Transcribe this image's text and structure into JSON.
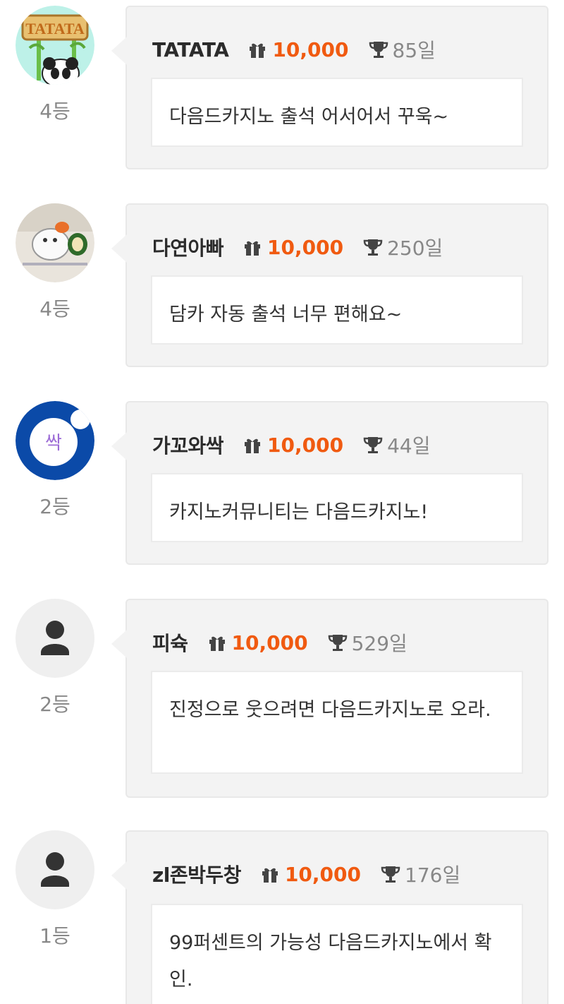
{
  "comments": [
    {
      "rank": "4등",
      "username": "TATATA",
      "points": "10,000",
      "days": "85일",
      "message": "다음드카지노 출석 어서어서 꾸욱~",
      "avatar_text": "TATATA"
    },
    {
      "rank": "4등",
      "username": "다연아빠",
      "points": "10,000",
      "days": "250일",
      "message": "담카 자동 출석 너무 편해요~",
      "avatar_text": ""
    },
    {
      "rank": "2등",
      "username": "가꼬와싹",
      "points": "10,000",
      "days": "44일",
      "message": "카지노커뮤니티는 다음드카지노!",
      "avatar_text": "싹"
    },
    {
      "rank": "2등",
      "username": "피슉",
      "points": "10,000",
      "days": "529일",
      "message": "진정으로 웃으려면 다음드카지노로 오라.",
      "avatar_text": ""
    },
    {
      "rank": "1등",
      "username": "zl존박두창",
      "points": "10,000",
      "days": "176일",
      "message": "99퍼센트의 가능성 다음드카지노에서 확인.",
      "avatar_text": ""
    }
  ],
  "icons": {
    "points": "gift-icon",
    "days": "trophy-icon",
    "default_avatar": "user-icon"
  },
  "colors": {
    "points": "#f05a10",
    "bubble": "#f3f3f3",
    "avatar_default": "#efefef",
    "avatar_blue": "#0b4aa8"
  }
}
